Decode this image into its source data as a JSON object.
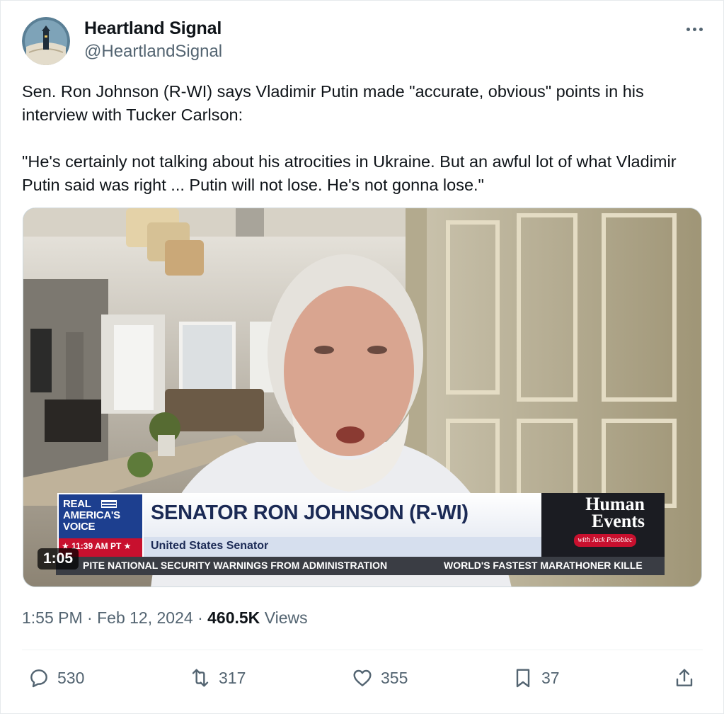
{
  "author": {
    "name": "Heartland Signal",
    "handle": "@HeartlandSignal",
    "avatar_icon": "heartland-signal-logo"
  },
  "tweet": {
    "paragraphs": [
      "Sen. Ron Johnson (R-WI) says Vladimir Putin made \"accurate, obvious\" points in his interview with Tucker Carlson:",
      "\"He's certainly not talking about his atrocities in Ukraine. But an awful lot of what Vladimir Putin said was right ... Putin will not lose. He's not gonna lose.\""
    ]
  },
  "video": {
    "duration": "1:05",
    "chyron": {
      "network_logo": "REAL AMERICA'S VOICE",
      "time": "11:39 AM PT",
      "name": "SENATOR RON JOHNSON (R-WI)",
      "title": "United States Senator",
      "show_logo": "Human Events",
      "show_host": "with Jack Posobiec",
      "ticker_left": "PITE NATIONAL SECURITY WARNINGS FROM ADMINISTRATION",
      "ticker_right": "WORLD'S FASTEST MARATHONER KILLE"
    }
  },
  "meta": {
    "time": "1:55 PM",
    "date": "Feb 12, 2024",
    "views_count": "460.5K",
    "views_label": "Views",
    "separator": "·"
  },
  "actions": {
    "replies": "530",
    "reposts": "317",
    "likes": "355",
    "bookmarks": "37"
  },
  "colors": {
    "text_primary": "#0f1419",
    "text_secondary": "#536471",
    "border": "#eff3f4"
  }
}
